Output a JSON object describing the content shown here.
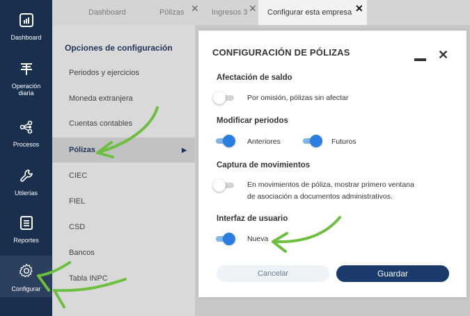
{
  "nav": {
    "items": [
      {
        "key": "dashboard",
        "label": "Dashboard",
        "icon": "bar-chart-icon"
      },
      {
        "key": "operacion",
        "label": "Operación diaria",
        "icon": "daily-operation-icon"
      },
      {
        "key": "procesos",
        "label": "Procesos",
        "icon": "process-nodes-icon"
      },
      {
        "key": "utilerias",
        "label": "Utilerías",
        "icon": "wrench-icon"
      },
      {
        "key": "reportes",
        "label": "Reportes",
        "icon": "report-list-icon"
      },
      {
        "key": "configurar",
        "label": "Configurar",
        "icon": "gear-icon"
      }
    ],
    "active": "configurar"
  },
  "tabs": [
    {
      "label": "Dashboard",
      "closable": false
    },
    {
      "label": "Pólizas",
      "closable": true
    },
    {
      "label": "Ingresos 3",
      "closable": true
    },
    {
      "label": "Configurar esta empresa",
      "closable": true,
      "active": true
    }
  ],
  "options": {
    "title": "Opciones de configuración",
    "items": [
      "Periodos y ejercicios",
      "Moneda extranjera",
      "Cuentas contables",
      "Pólizas",
      "CIEC",
      "FIEL",
      "CSD",
      "Bancos",
      "Tabla INPC"
    ],
    "selected": "Pólizas"
  },
  "modal": {
    "title": "CONFIGURACIÓN DE PÓLIZAS",
    "sections": {
      "afectacion": {
        "title": "Afectación de saldo",
        "toggle_label": "Por omisión, pólizas sin afectar",
        "toggle_on": false
      },
      "periodos": {
        "title": "Modificar periodos",
        "anteriores_label": "Anteriores",
        "anteriores_on": true,
        "futuros_label": "Futuros",
        "futuros_on": true
      },
      "captura": {
        "title": "Captura de movimientos",
        "toggle_label_line1": "En movimientos de póliza, mostrar primero ventana",
        "toggle_label_line2": "de asociación a documentos administrativos.",
        "toggle_on": false
      },
      "interfaz": {
        "title": "Interfaz de usuario",
        "toggle_label": "Nueva",
        "toggle_on": true
      }
    },
    "cancel_label": "Cancelar",
    "save_label": "Guardar"
  },
  "colors": {
    "rail": "#1a2e4d",
    "accent": "#2a7de1",
    "save_button": "#1a3a6b",
    "annotation_arrow": "#6cbf3f"
  }
}
